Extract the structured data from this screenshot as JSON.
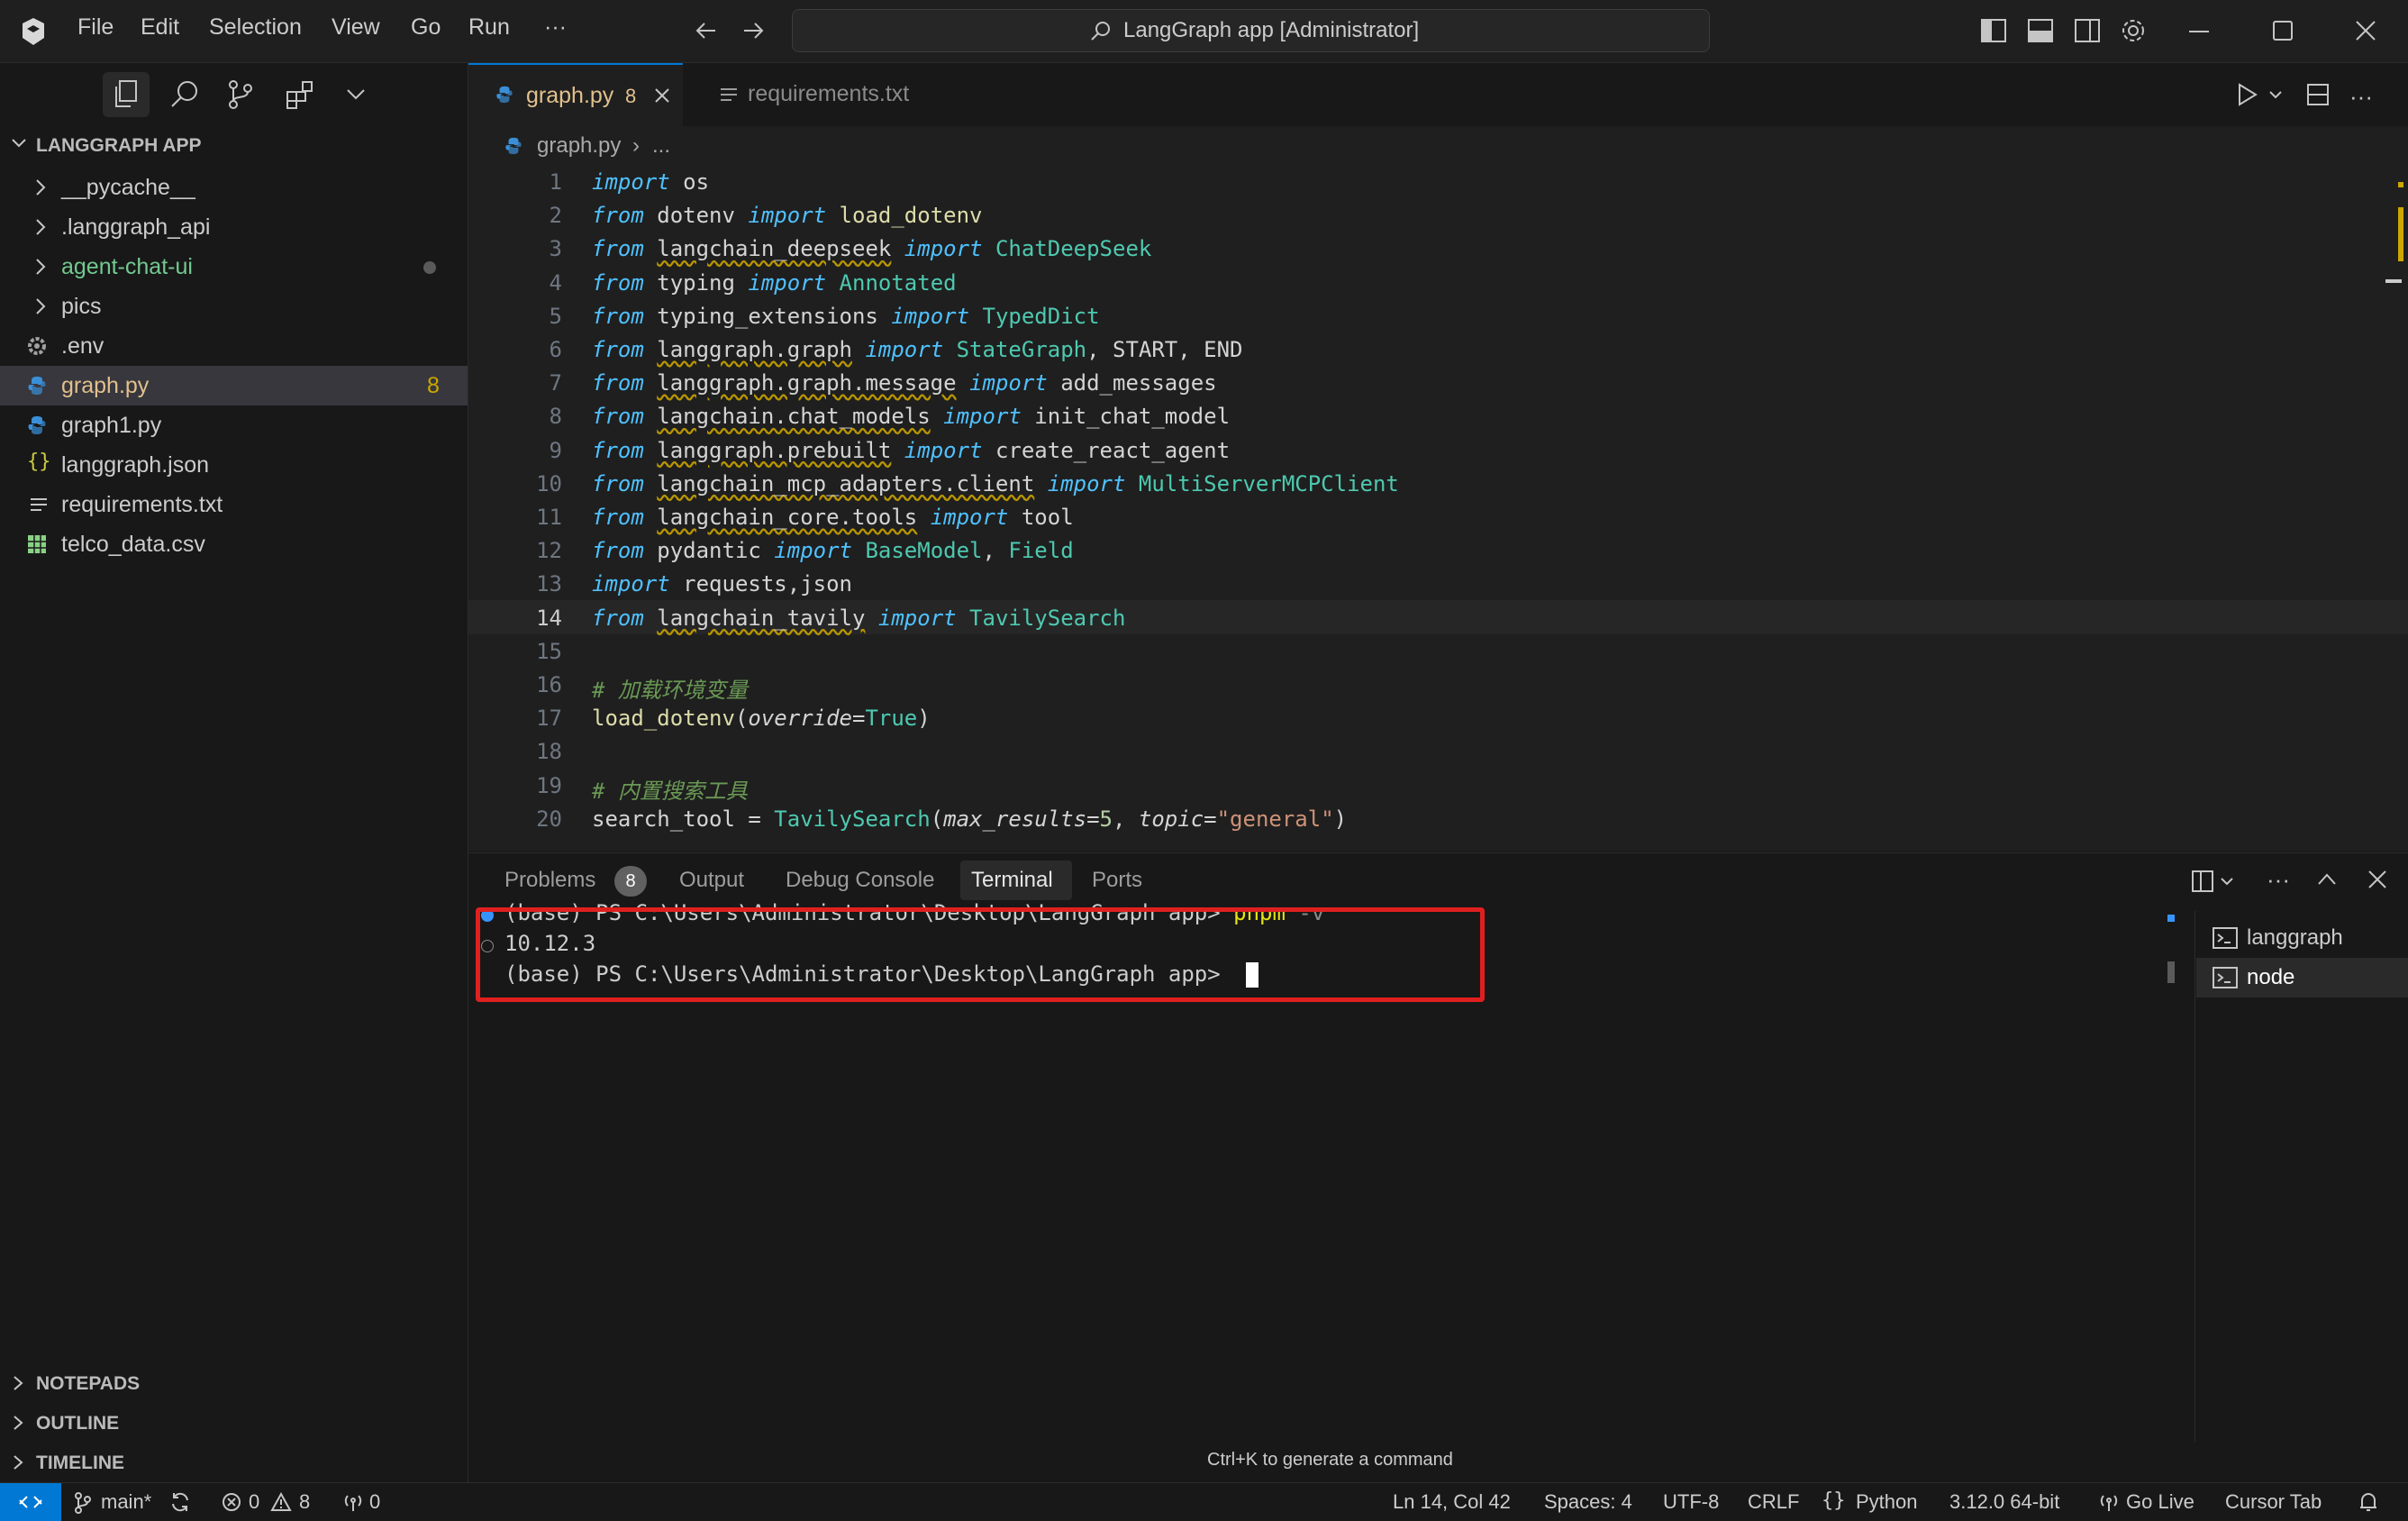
{
  "window": {
    "title": "LangGraph app [Administrator]",
    "menu": [
      "File",
      "Edit",
      "Selection",
      "View",
      "Go",
      "Run",
      "···"
    ]
  },
  "sidebar": {
    "root": "LANGGRAPH APP",
    "items": [
      {
        "label": "__pycache__",
        "type": "folder"
      },
      {
        "label": ".langgraph_api",
        "type": "folder"
      },
      {
        "label": "agent-chat-ui",
        "type": "folder"
      },
      {
        "label": "pics",
        "type": "folder"
      },
      {
        "label": ".env",
        "type": "file"
      },
      {
        "label": "graph.py",
        "type": "file",
        "badge": "8"
      },
      {
        "label": "graph1.py",
        "type": "file"
      },
      {
        "label": "langgraph.json",
        "type": "file"
      },
      {
        "label": "requirements.txt",
        "type": "file"
      },
      {
        "label": "telco_data.csv",
        "type": "file"
      }
    ],
    "sections": [
      "NOTEPADS",
      "OUTLINE",
      "TIMELINE"
    ]
  },
  "tabs": [
    {
      "label": "graph.py",
      "badge": "8",
      "active": true
    },
    {
      "label": "requirements.txt",
      "active": false
    }
  ],
  "breadcrumb": {
    "file": "graph.py",
    "rest": "..."
  },
  "code": {
    "current_line": 14,
    "lines": [
      "import os",
      "from dotenv import load_dotenv",
      "from langchain_deepseek import ChatDeepSeek",
      "from typing import Annotated",
      "from typing_extensions import TypedDict",
      "from langgraph.graph import StateGraph, START, END",
      "from langgraph.graph.message import add_messages",
      "from langchain.chat_models import init_chat_model",
      "from langgraph.prebuilt import create_react_agent",
      "from langchain_mcp_adapters.client import MultiServerMCPClient",
      "from langchain_core.tools import tool",
      "from pydantic import BaseModel, Field",
      "import requests,json",
      "from langchain_tavily import TavilySearch",
      "",
      "# 加载环境变量",
      "load_dotenv(override=True)",
      "",
      "# 内置搜索工具",
      "search_tool = TavilySearch(max_results=5, topic=\"general\")"
    ]
  },
  "panel": {
    "tabs": [
      "Problems",
      "Output",
      "Debug Console",
      "Terminal",
      "Ports"
    ],
    "problems_count": "8",
    "active_tab": "Terminal",
    "terminal_lines": [
      {
        "prompt": "(base) PS C:\\Users\\Administrator\\Desktop\\LangGraph app> ",
        "cmd": "pnpm",
        "arg": " -v"
      },
      {
        "output": "10.12.3"
      },
      {
        "prompt": "(base) PS C:\\Users\\Administrator\\Desktop\\LangGraph app> ",
        "cmd": "",
        "arg": ""
      }
    ],
    "terminals": [
      "langgraph",
      "node"
    ],
    "hint": "Ctrl+K to generate a command"
  },
  "statusbar": {
    "branch": "main*",
    "errors": "0",
    "warnings": "8",
    "ports": "0",
    "position": "Ln 14, Col 42",
    "spaces": "Spaces: 4",
    "encoding": "UTF-8",
    "eol": "CRLF",
    "language": "Python",
    "interpreter": "3.12.0 64-bit",
    "golive": "Go Live",
    "cursor_tab": "Cursor Tab"
  },
  "colors": {
    "accent": "#0078d4",
    "highlight_box": "#e02020",
    "folder_modified": "#73c991",
    "badge": "#cca700"
  }
}
